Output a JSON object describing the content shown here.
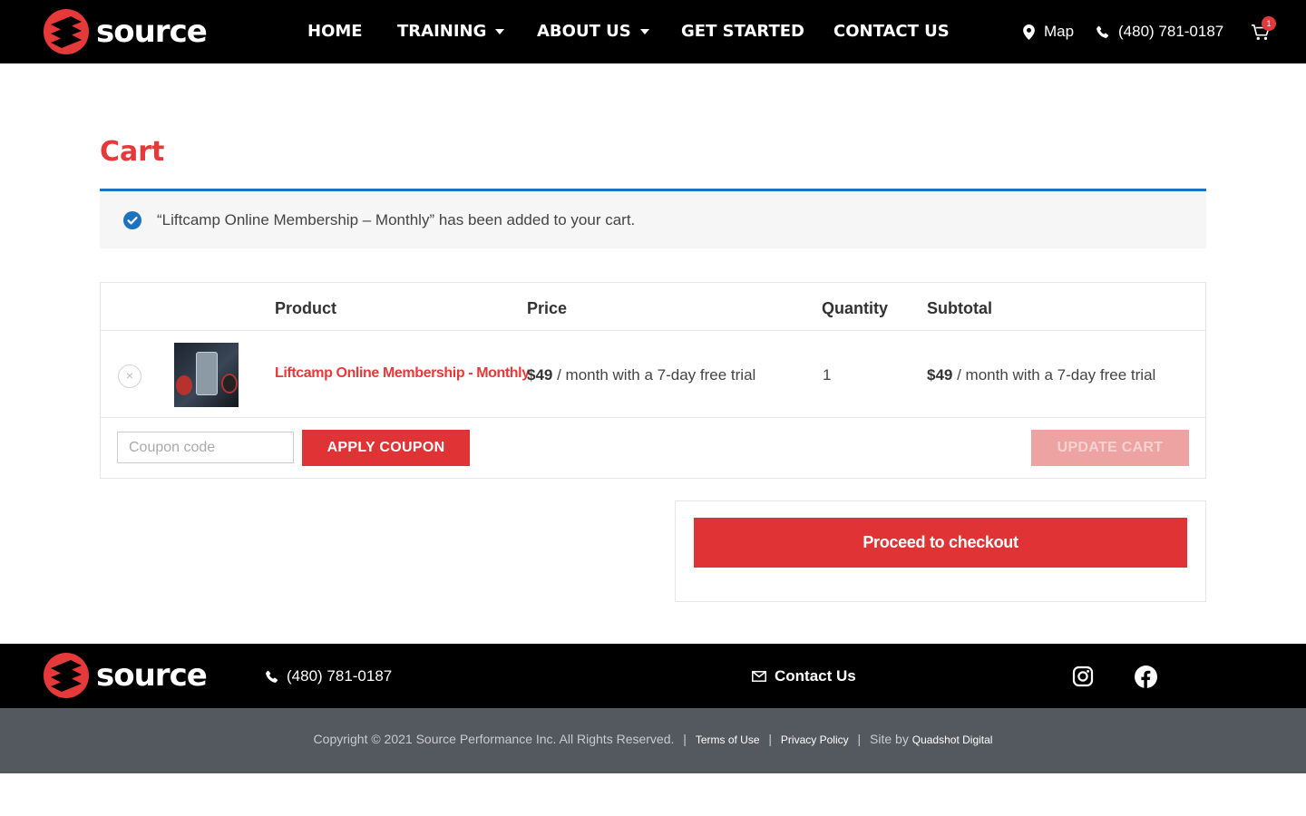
{
  "brand": {
    "name": "source",
    "accent": "#e6393a",
    "notice_blue": "#1e73be"
  },
  "nav": {
    "items": [
      {
        "label": "HOME"
      },
      {
        "label": "TRAINING"
      },
      {
        "label": "ABOUT US"
      },
      {
        "label": "GET STARTED"
      },
      {
        "label": "CONTACT US"
      }
    ],
    "map_label": "Map",
    "phone": "(480) 781-0187",
    "cart_count": "1"
  },
  "page": {
    "title": "Cart",
    "notice": "“Liftcamp Online Membership – Monthly” has been added to your cart."
  },
  "cart": {
    "headers": {
      "product": "Product",
      "price": "Price",
      "quantity": "Quantity",
      "subtotal": "Subtotal"
    },
    "items": [
      {
        "remove": "×",
        "name": "Liftcamp Online Membership - Monthly",
        "price_amount": "$49",
        "price_suffix": " / month with a 7-day free trial",
        "quantity": "1",
        "subtotal_amount": "$49",
        "subtotal_suffix": " / month with a 7-day free trial"
      }
    ],
    "coupon_placeholder": "Coupon code",
    "apply_coupon_label": "APPLY COUPON",
    "update_cart_label": "UPDATE CART"
  },
  "totals": {
    "checkout_label": "Proceed to checkout"
  },
  "footer": {
    "phone": "(480) 781-0187",
    "contact_label": "Contact Us",
    "copyright": "Copyright © 2021 Source Performance Inc.  All Rights Reserved.",
    "sep": "|",
    "terms": "Terms of Use",
    "privacy": "Privacy Policy",
    "site_by": "Site by",
    "site_by_link": "Quadshot Digital",
    "icons": [
      "instagram-icon",
      "facebook-icon"
    ]
  }
}
